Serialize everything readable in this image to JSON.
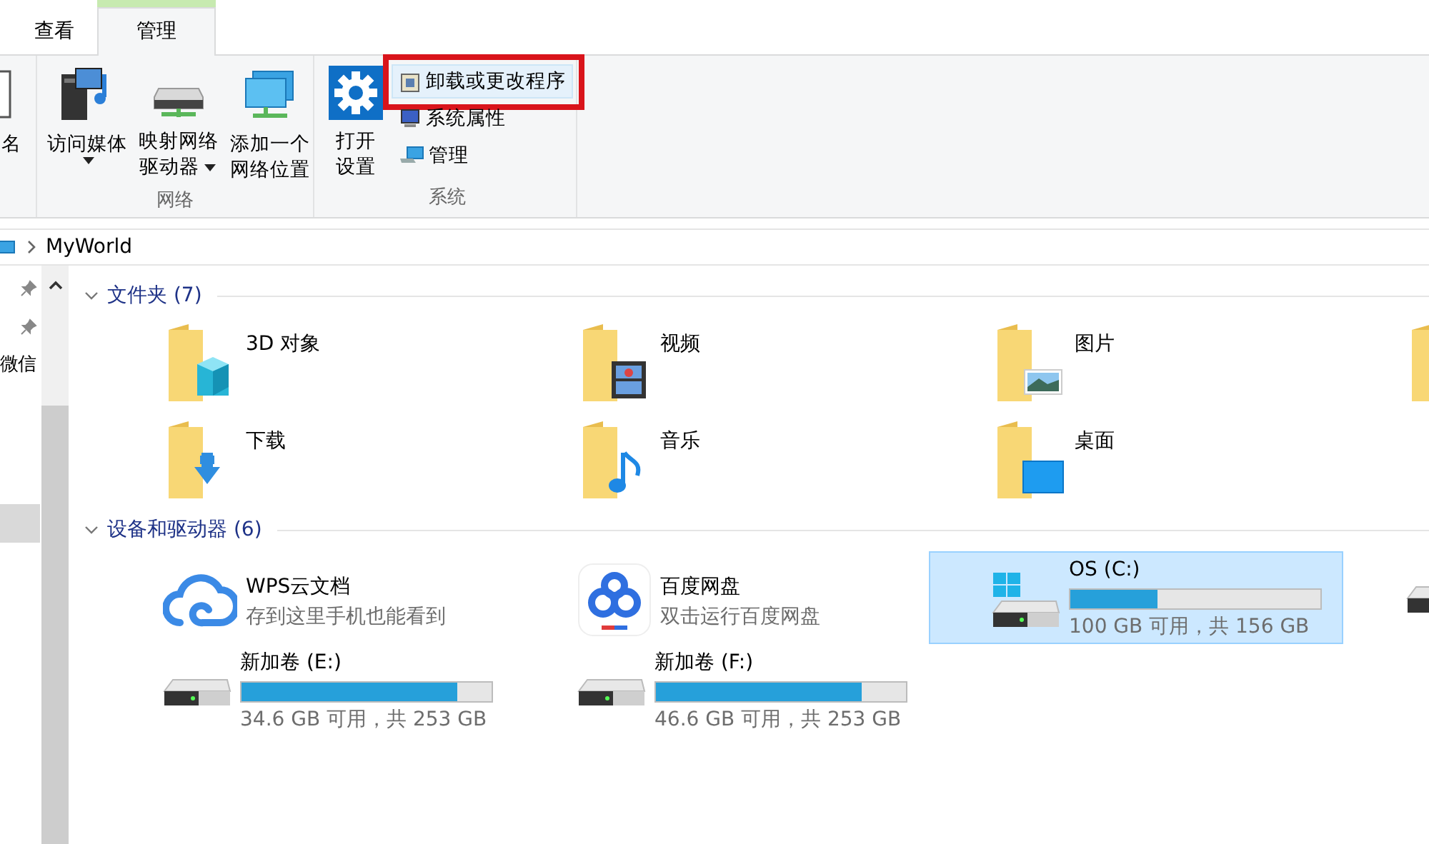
{
  "tabs": [
    {
      "label": "查看",
      "selected": false
    },
    {
      "label": "管理",
      "selected": true
    }
  ],
  "ribbon_groups": [
    {
      "buttons": [
        {
          "lines": [
            "名"
          ],
          "dropdown": false
        }
      ]
    },
    {
      "label": "网络",
      "buttons": [
        {
          "lines": [
            "访问媒体"
          ],
          "dropdown": true
        },
        {
          "lines": [
            "映射网络",
            "驱动器"
          ],
          "dropdown": true
        },
        {
          "lines": [
            "添加一个",
            "网络位置"
          ],
          "dropdown": false
        }
      ]
    },
    {
      "label": "系统",
      "buttons": [
        {
          "lines": [
            "打开",
            "设置"
          ],
          "dropdown": false
        }
      ],
      "small_buttons": [
        {
          "label": "卸载或更改程序",
          "highlighted": true,
          "annotated": true
        },
        {
          "label": "系统属性",
          "highlighted": false,
          "annotated": false
        },
        {
          "label": "管理",
          "highlighted": false,
          "annotated": false
        }
      ]
    }
  ],
  "address": {
    "path": [
      "MyWorld"
    ]
  },
  "nav": {
    "items": [
      {
        "pinned": true,
        "selected": false
      },
      {
        "pinned": true,
        "selected": false
      },
      {
        "label": "微信",
        "pinned": false,
        "selected": false
      },
      {
        "pinned": false,
        "selected": true
      }
    ]
  },
  "sections": [
    {
      "title": "文件夹 (7)",
      "expanded": true,
      "items": [
        {
          "kind": "folder",
          "label": "3D 对象"
        },
        {
          "kind": "folder",
          "label": "视频"
        },
        {
          "kind": "folder",
          "label": "图片"
        },
        {
          "kind": "folder"
        },
        {
          "kind": "folder",
          "label": "下载"
        },
        {
          "kind": "folder",
          "label": "音乐"
        },
        {
          "kind": "folder",
          "label": "桌面"
        }
      ]
    },
    {
      "title": "设备和驱动器 (6)",
      "expanded": true,
      "items": [
        {
          "kind": "app",
          "label": "WPS云文档",
          "subtitle": "存到这里手机也能看到",
          "selected": false
        },
        {
          "kind": "app",
          "label": "百度网盘",
          "subtitle": "双击运行百度网盘",
          "selected": false
        },
        {
          "kind": "drive",
          "label": "OS (C:)",
          "level": 0.35,
          "reading": "100 GB 可用，共 156 GB",
          "selected": true
        },
        {
          "kind": "drive",
          "selected": false
        },
        {
          "kind": "drive",
          "label": "新加卷 (E:)",
          "level": 0.86,
          "reading": "34.6 GB 可用，共 253 GB",
          "selected": false
        },
        {
          "kind": "drive",
          "label": "新加卷 (F:)",
          "level": 0.82,
          "reading": "46.6 GB 可用，共 253 GB",
          "selected": false
        }
      ]
    }
  ]
}
